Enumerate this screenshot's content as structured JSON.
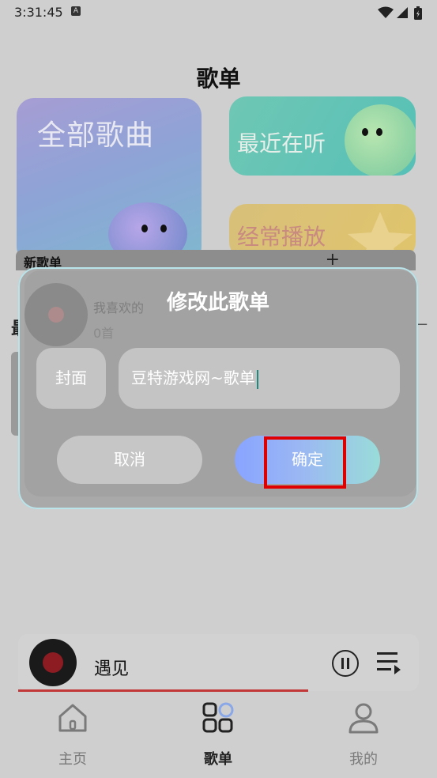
{
  "status_bar": {
    "time": "3:31:45",
    "notification_glyph": "A"
  },
  "page": {
    "title": "歌单"
  },
  "cards": {
    "all_songs": "全部歌曲",
    "recent": "最近在听",
    "often_played": "经常播放"
  },
  "playlist_header": {
    "label": "新歌单",
    "add_symbol": "+"
  },
  "background_playlist": {
    "name": "我喜欢的",
    "count": "0首"
  },
  "side_hints": {
    "left": "最",
    "right": "−"
  },
  "dialog": {
    "title": "修改此歌单",
    "cover_label": "封面",
    "name_value": "豆特游戏网~歌单",
    "cancel_label": "取消",
    "confirm_label": "确定"
  },
  "player": {
    "song_title": "遇见"
  },
  "bottom_nav": [
    {
      "label": "主页",
      "icon": "home-icon"
    },
    {
      "label": "歌单",
      "icon": "songlist-icon",
      "active": true
    },
    {
      "label": "我的",
      "icon": "profile-icon"
    }
  ],
  "colors": {
    "accent_red": "#c23838",
    "highlight_border": "#e00000",
    "confirm_gradient_start": "#88a4ff",
    "confirm_gradient_end": "#99dcd9"
  }
}
